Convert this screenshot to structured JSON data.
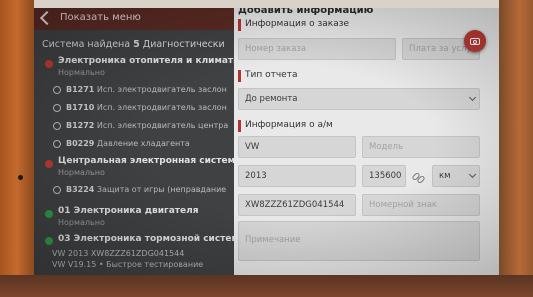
{
  "left_panel": {
    "back_label": "Показать меню",
    "systems_found": {
      "prefix": "Система найдена",
      "count": "5",
      "suffix": "Диагностически"
    },
    "sections": [
      {
        "title": "Электроника отопителя и климатич",
        "status": "Нормально",
        "codes": [
          {
            "code": "B1271",
            "text": "Исп. электродвигатель заслон"
          },
          {
            "code": "B1710",
            "text": "Исп. электродвигатель заслон"
          },
          {
            "code": "B1272",
            "text": "Исп. электродвигатель центра"
          },
          {
            "code": "B0229",
            "text": "Давление хладагента"
          }
        ]
      },
      {
        "title": "Центральная электронная система",
        "status": "Нормально",
        "codes": [
          {
            "code": "B3224",
            "text": "Защита от игры (неправдание"
          }
        ]
      },
      {
        "title": "01 Электроника двигателя",
        "status": "Нормально"
      },
      {
        "title": "03 Электроника тормозной системы",
        "status": ""
      }
    ],
    "footer_vin": "VW 2013  XW8ZZZ61ZDG041544",
    "footer_version": "VW V19.15 • Быстрое тестирование"
  },
  "form": {
    "title": "Добавить информацию",
    "order_section": "Информация о заказе",
    "order_number_placeholder": "Номер заказа",
    "payment_placeholder": "Плата за услуги",
    "report_type_section": "Тип отчета",
    "report_type_value": "До ремонта",
    "vehicle_section": "Информация о а/м",
    "make": "VW",
    "model_placeholder": "Модель",
    "year": "2013",
    "mileage": "135600",
    "unit": "км",
    "vin": "XW8ZZZ61ZDG041544",
    "plate_placeholder": "Номерной знак",
    "notes_placeholder": "Примечание"
  },
  "colors": {
    "accent": "#b93a34",
    "ok": "#2f9a4a",
    "panel_bg": "#e9e9ea"
  },
  "icons": {
    "back": "chevron-left",
    "camera": "camera",
    "link": "link"
  }
}
